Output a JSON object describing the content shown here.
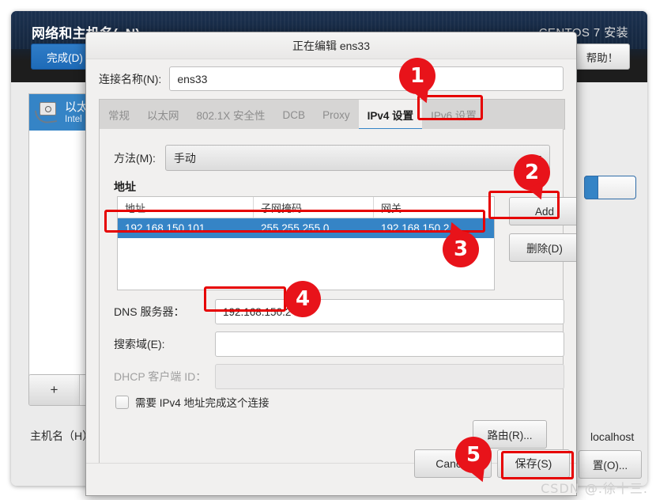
{
  "installer": {
    "title": "网络和主机名(_N)",
    "brand": "CENTOS 7 安装",
    "done_label": "完成(D)",
    "help_label": "帮助！",
    "device": {
      "name": "以太网",
      "sub": "Intel "
    },
    "device_buttons": {
      "add": "+",
      "remove": "−"
    },
    "hostname_label": "主机名（H）",
    "config_label": "置(O)...",
    "localhost": "localhost"
  },
  "dialog": {
    "title": "正在编辑 ens33",
    "conn_name_label": "连接名称(N):",
    "conn_name_value": "ens33",
    "tabs": [
      {
        "label": "常规",
        "active": false
      },
      {
        "label": "以太网",
        "active": false
      },
      {
        "label": "802.1X 安全性",
        "active": false
      },
      {
        "label": "DCB",
        "active": false
      },
      {
        "label": "Proxy",
        "active": false
      },
      {
        "label": "IPv4 设置",
        "active": true
      },
      {
        "label": "IPv6 设置",
        "active": false
      }
    ],
    "method_label": "方法(M):",
    "method_value": "手动",
    "address_heading": "地址",
    "address_table": {
      "headers": [
        "地址",
        "子网掩码",
        "网关"
      ],
      "rows": [
        [
          "192.168.150.101",
          "255.255.255.0",
          "192.168.150.2"
        ]
      ]
    },
    "add_label": "Add",
    "delete_label": "删除(D)",
    "dns_label": "DNS 服务器：",
    "dns_value": "192.168.150.2",
    "search_label": "搜索域(E):",
    "search_value": "",
    "dhcp_label": "DHCP 客户端 ID：",
    "dhcp_value": "",
    "require_label": "需要 IPv4 地址完成这个连接",
    "routes_label": "路由(R)...",
    "cancel_label": "Cancel",
    "save_label": "保存(S)"
  },
  "annotations": {
    "markers": [
      "1",
      "2",
      "3",
      "4",
      "5"
    ]
  },
  "watermark": "CSDN @.徐十三.",
  "colors": {
    "accent_blue": "#3584c6",
    "annotation_red": "#e8131a",
    "header_dark": "#16283f"
  }
}
